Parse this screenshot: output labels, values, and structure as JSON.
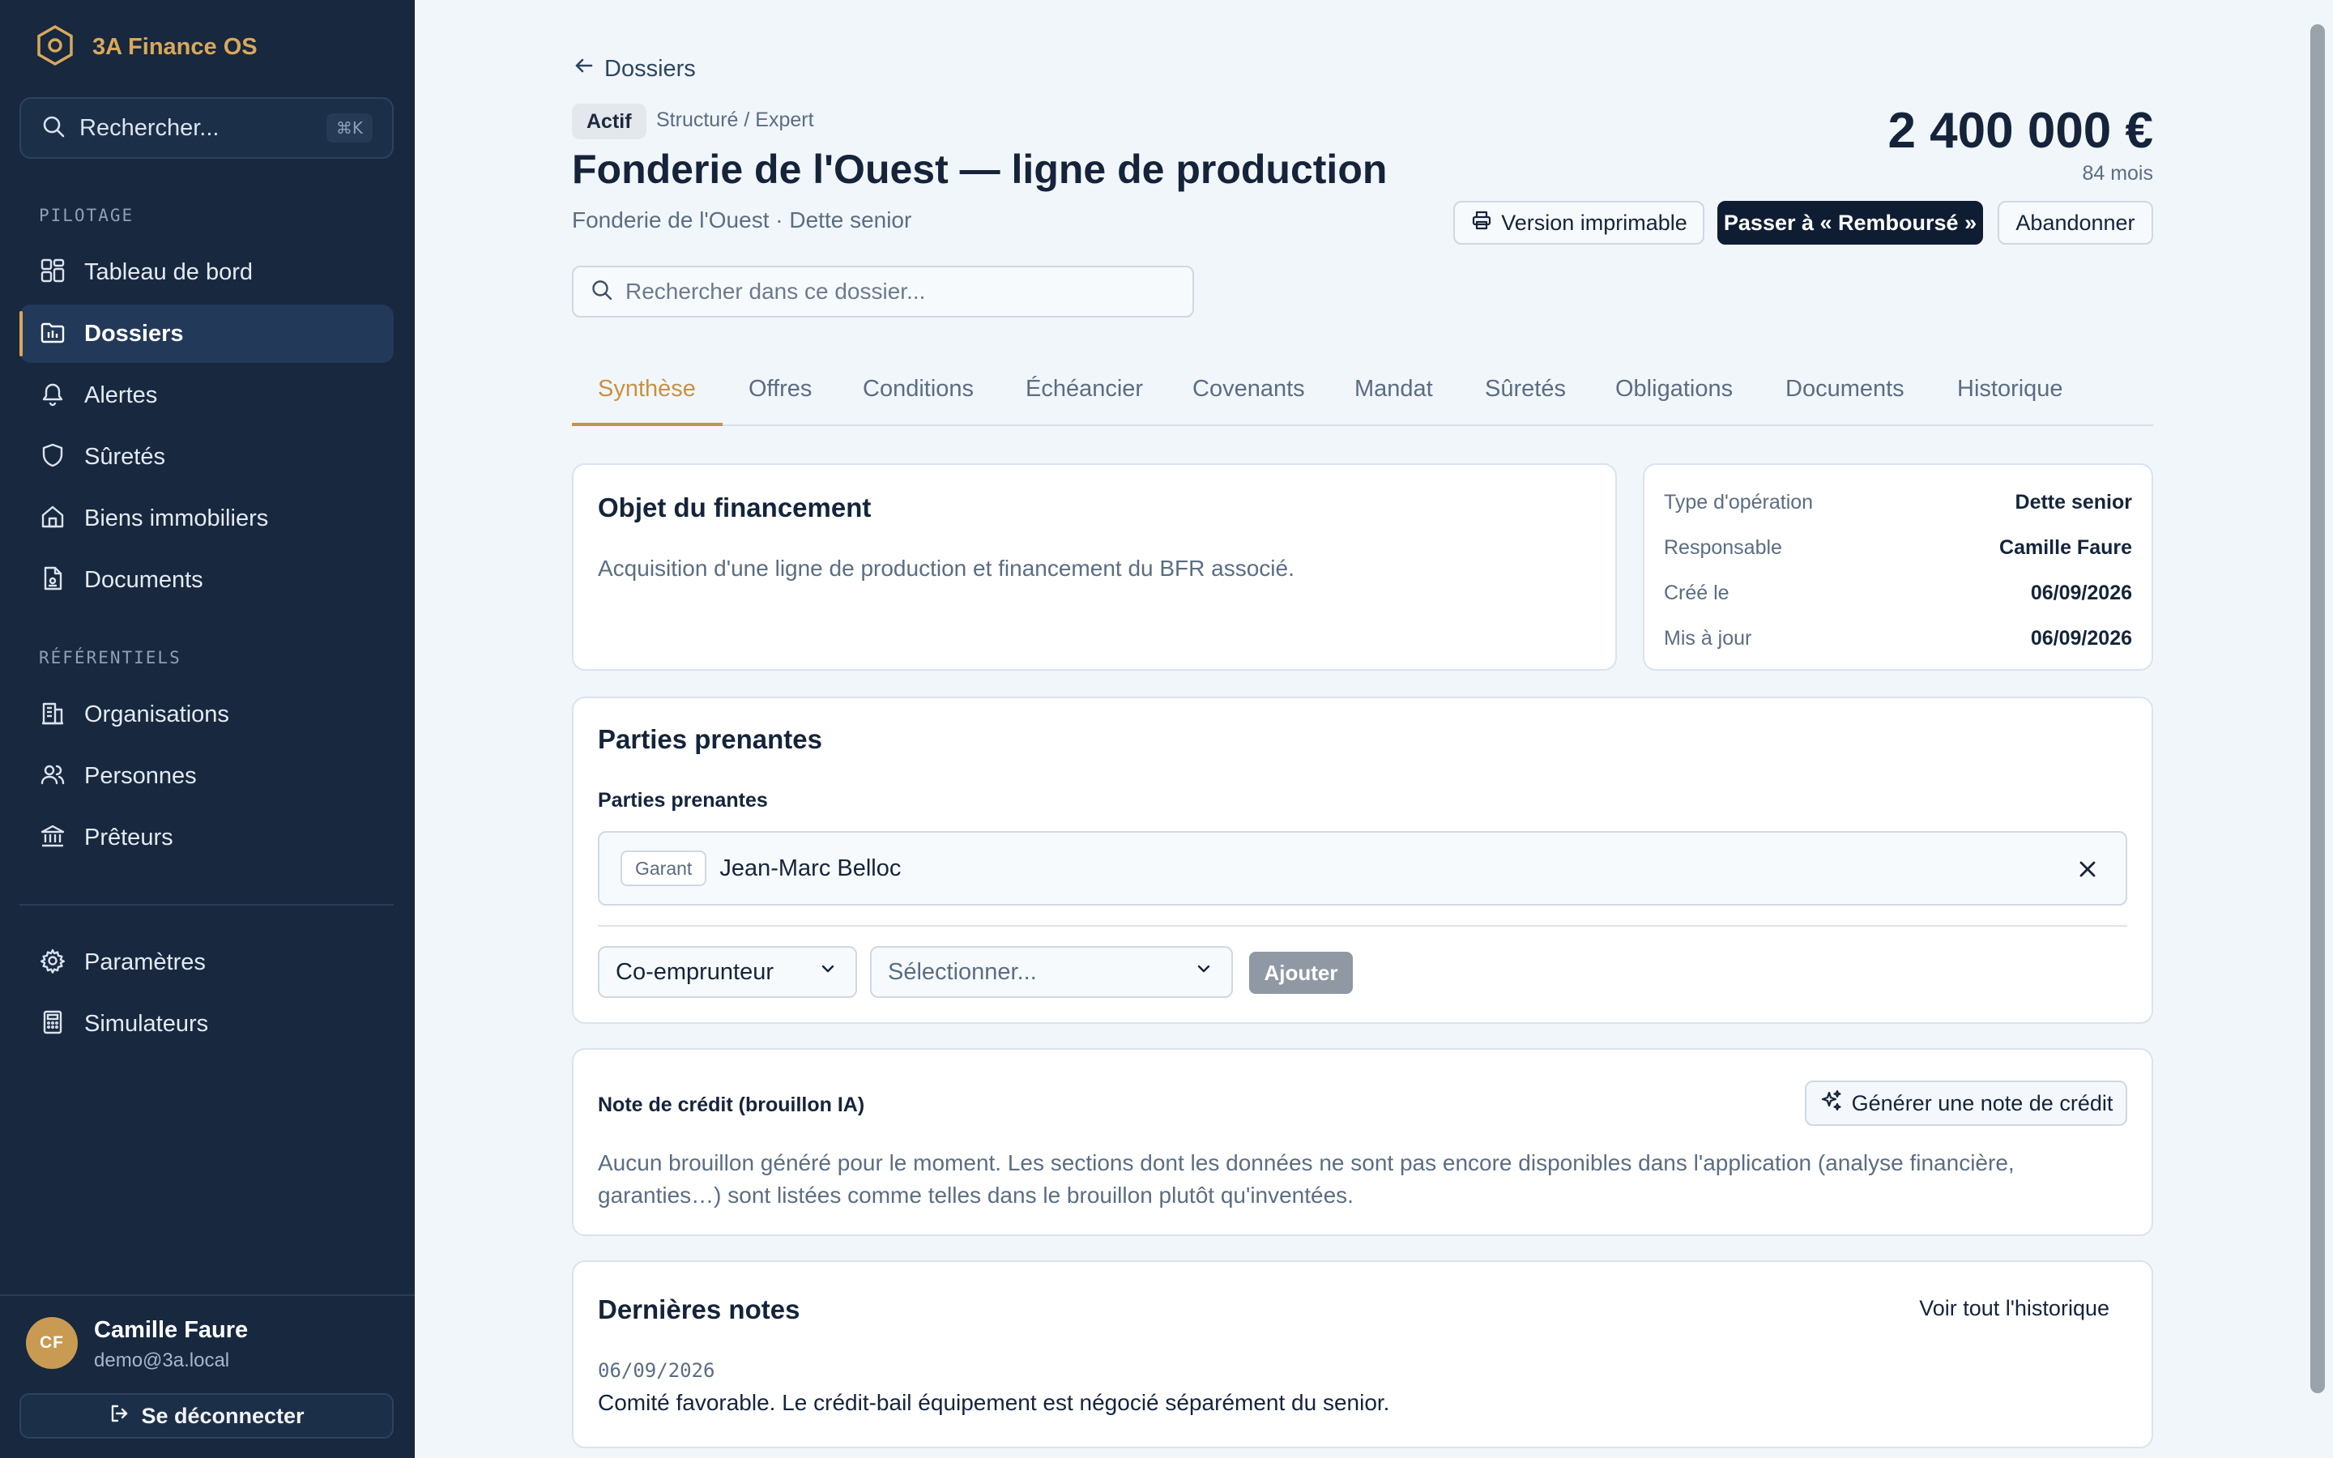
{
  "app": {
    "name": "3A Finance OS"
  },
  "colors": {
    "sidebar_bg": "#17283f",
    "accent": "#c99140",
    "primary_button": "#0f1d33",
    "page_bg": "#f1f6fb"
  },
  "sidebar": {
    "search_placeholder": "Rechercher...",
    "search_shortcut": "⌘K",
    "section_pilotage": "PILOTAGE",
    "section_referentiels": "RÉFÉRENTIELS",
    "items": [
      {
        "label": "Tableau de bord",
        "icon": "dashboard-icon"
      },
      {
        "label": "Dossiers",
        "icon": "folder-icon",
        "active": true
      },
      {
        "label": "Alertes",
        "icon": "bell-icon"
      },
      {
        "label": "Sûretés",
        "icon": "shield-icon"
      },
      {
        "label": "Biens immobiliers",
        "icon": "home-icon"
      },
      {
        "label": "Documents",
        "icon": "document-icon"
      }
    ],
    "ref_items": [
      {
        "label": "Organisations",
        "icon": "building-icon"
      },
      {
        "label": "Personnes",
        "icon": "users-icon"
      },
      {
        "label": "Prêteurs",
        "icon": "bank-icon"
      }
    ],
    "bottom_items": [
      {
        "label": "Paramètres",
        "icon": "gear-icon"
      },
      {
        "label": "Simulateurs",
        "icon": "calculator-icon"
      }
    ],
    "user": {
      "initials": "CF",
      "name": "Camille Faure",
      "email": "demo@3a.local"
    },
    "logout_label": "Se déconnecter"
  },
  "header": {
    "back_label": "Dossiers",
    "status": "Actif",
    "category": "Structuré / Expert",
    "title": "Fonderie de l'Ouest — ligne de production",
    "subtitle": "Fonderie de l'Ouest · Dette senior",
    "amount": "2 400 000 €",
    "duration": "84 mois",
    "actions": {
      "print": "Version imprimable",
      "advance": "Passer à « Remboursé »",
      "abandon": "Abandonner"
    },
    "search_placeholder": "Rechercher dans ce dossier..."
  },
  "tabs": [
    "Synthèse",
    "Offres",
    "Conditions",
    "Échéancier",
    "Covenants",
    "Mandat",
    "Sûretés",
    "Obligations",
    "Documents",
    "Historique"
  ],
  "objet": {
    "title": "Objet du financement",
    "text": "Acquisition d'une ligne de production et financement du BFR associé."
  },
  "details": [
    {
      "key": "Type d'opération",
      "value": "Dette senior"
    },
    {
      "key": "Responsable",
      "value": "Camille Faure"
    },
    {
      "key": "Créé le",
      "value": "06/09/2026"
    },
    {
      "key": "Mis à jour",
      "value": "06/09/2026"
    }
  ],
  "stakeholders": {
    "title": "Parties prenantes",
    "field_label": "Parties prenantes",
    "entries": [
      {
        "role": "Garant",
        "name": "Jean-Marc Belloc"
      }
    ],
    "role_select": "Co-emprunteur",
    "person_placeholder": "Sélectionner...",
    "add_label": "Ajouter"
  },
  "credit_note": {
    "label": "Note de crédit (brouillon IA)",
    "button": "Générer une note de crédit",
    "text_line1": "Aucun brouillon généré pour le moment. Les sections dont les données ne sont pas encore disponibles dans l'application (analyse financière,",
    "text_line2": "garanties…) sont listées comme telles dans le brouillon plutôt qu'inventées."
  },
  "notes": {
    "title": "Dernières notes",
    "link": "Voir tout l'historique",
    "items": [
      {
        "date": "06/09/2026",
        "text": "Comité favorable. Le crédit-bail équipement est négocié séparément du senior."
      }
    ]
  }
}
